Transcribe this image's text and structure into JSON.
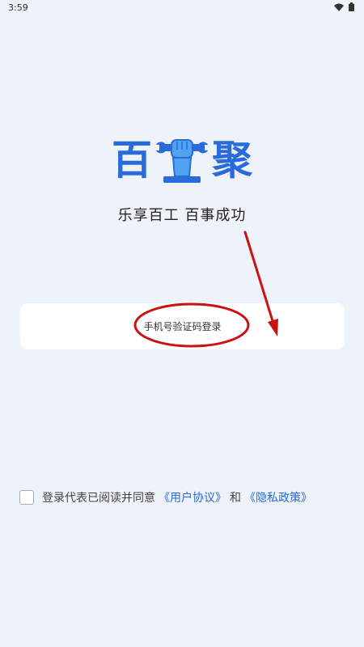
{
  "status_bar": {
    "time": "3:59",
    "icons": [
      "wifi-icon",
      "battery-icon"
    ]
  },
  "logo": {
    "char_left": "百",
    "char_right": "聚",
    "middle_icon": "fist-wrench-icon",
    "brand_color": "#2a6bdc"
  },
  "slogan": "乐享百工 百事成功",
  "login": {
    "label": "手机号验证码登录"
  },
  "agreement": {
    "prefix": "登录代表已阅读并同意",
    "user_agreement": "《用户协议》",
    "conjunction": "和",
    "privacy_policy": "《隐私政策》",
    "checked": false
  },
  "annotation": {
    "color": "#cc1111",
    "shapes": [
      "ellipse",
      "arrow"
    ]
  }
}
